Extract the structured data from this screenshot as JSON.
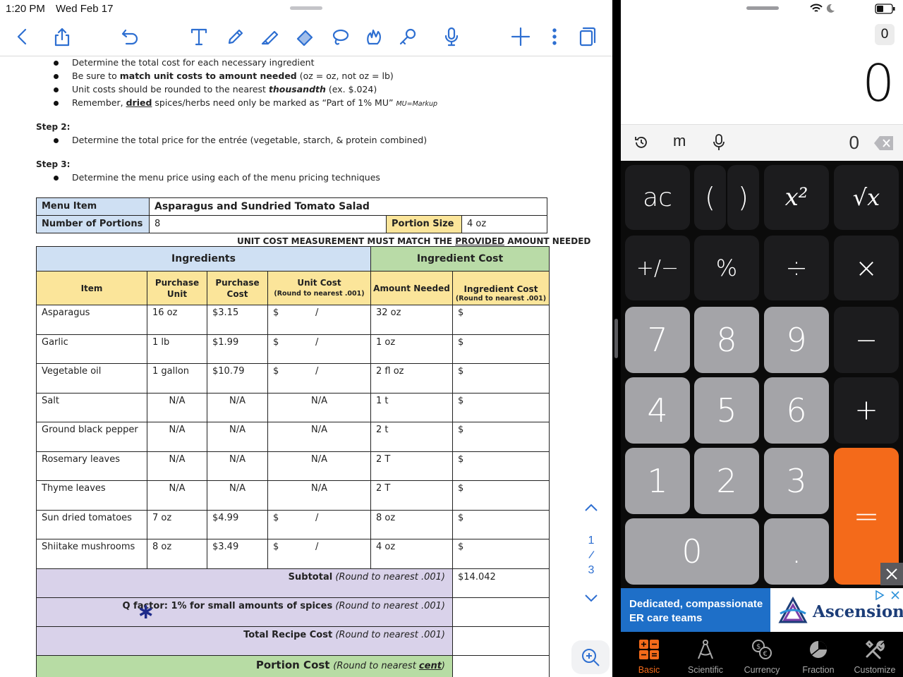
{
  "status_bar": {
    "time": "1:20 PM",
    "date": "Wed Feb 17"
  },
  "toolbar": {
    "icons": [
      "back-icon",
      "share-icon",
      "undo-icon",
      "text-tool-icon",
      "pen-icon",
      "highlighter-icon",
      "eraser-icon",
      "lasso-icon",
      "shapes-icon",
      "laser-pointer-icon",
      "microphone-icon",
      "add-icon",
      "more-icon",
      "pages-icon"
    ],
    "accent": "#2e6fd1"
  },
  "doc": {
    "bullets_step1": [
      "Determine the total cost for each necessary ingredient",
      "Be sure to match unit costs to amount needed (oz = oz, not oz = lb)",
      "Unit costs should be rounded to the nearest thousandth (ex. $.024)",
      "Remember, dried spices/herbs need only be marked as “Part of 1% MU” MU=Markup"
    ],
    "b2_pre": "Be sure to ",
    "b2_bold": "match unit costs to amount needed",
    "b2_post": " (oz = oz, not oz = lb)",
    "b3_pre": "Unit costs should be rounded to the nearest ",
    "b3_em": "thousandth",
    "b3_post": " (ex. $.024)",
    "b4_pre": "Remember, ",
    "b4_u": "dried",
    "b4_post": " spices/herbs need only be marked as “Part of 1% MU” ",
    "b4_note": "MU=Markup",
    "step2_label": "Step 2:",
    "step2_bullet": "Determine the total price for the entrée (vegetable, starch, & protein combined)",
    "step3_label": "Step 3:",
    "step3_bullet": "Determine the menu price using each of the menu pricing techniques"
  },
  "menu_table": {
    "menu_item_label": "Menu Item",
    "menu_item_value": "Asparagus and Sundried Tomato Salad",
    "portions_label": "Number of Portions",
    "portions_value": "8",
    "portion_size_label": "Portion Size",
    "portion_size_value": "4 oz"
  },
  "unit_note": {
    "pre": "UNIT COST MEASUREMENT MUST MATCH THE ",
    "u": "PROVIDED",
    "post": " AMOUNT NEEDED"
  },
  "ingredients_table": {
    "group_ingredients": "Ingredients",
    "group_cost": "Ingredient Cost",
    "headers": {
      "item": "Item",
      "purchase_unit_1": "Purchase",
      "purchase_unit_2": "Unit",
      "purchase_cost_1": "Purchase",
      "purchase_cost_2": "Cost",
      "unit_cost": "Unit Cost",
      "unit_cost_note": "(Round to nearest .001)",
      "amount_needed": "Amount Needed",
      "ingredient_cost": "Ingredient Cost",
      "ingredient_cost_note": "(Round to nearest .001)"
    },
    "rows": [
      {
        "item": "Asparagus",
        "unit": "16 oz",
        "cost": "$3.15",
        "uc_dollar": "$",
        "uc_slash": "/",
        "uc_na": "",
        "amount": "32 oz",
        "ic": "$"
      },
      {
        "item": "Garlic",
        "unit": "1 lb",
        "cost": "$1.99",
        "uc_dollar": "$",
        "uc_slash": "/",
        "uc_na": "",
        "amount": "1 oz",
        "ic": "$"
      },
      {
        "item": "Vegetable oil",
        "unit": "1 gallon",
        "cost": "$10.79",
        "uc_dollar": "$",
        "uc_slash": "/",
        "uc_na": "",
        "amount": "2 fl oz",
        "ic": "$"
      },
      {
        "item": "Salt",
        "unit": "N/A",
        "cost": "N/A",
        "uc_dollar": "",
        "uc_slash": "",
        "uc_na": "N/A",
        "amount": "1 t",
        "ic": "$"
      },
      {
        "item": "Ground black pepper",
        "unit": "N/A",
        "cost": "N/A",
        "uc_dollar": "",
        "uc_slash": "",
        "uc_na": "N/A",
        "amount": "2 t",
        "ic": "$"
      },
      {
        "item": "Rosemary leaves",
        "unit": "N/A",
        "cost": "N/A",
        "uc_dollar": "",
        "uc_slash": "",
        "uc_na": "N/A",
        "amount": "2 T",
        "ic": "$"
      },
      {
        "item": "Thyme leaves",
        "unit": "N/A",
        "cost": "N/A",
        "uc_dollar": "",
        "uc_slash": "",
        "uc_na": "N/A",
        "amount": "2 T",
        "ic": "$"
      },
      {
        "item": "Sun dried tomatoes",
        "unit": "7 oz",
        "cost": "$4.99",
        "uc_dollar": "$",
        "uc_slash": "/",
        "uc_na": "",
        "amount": "8 oz",
        "ic": "$"
      },
      {
        "item": "Shiitake mushrooms",
        "unit": "8 oz",
        "cost": "$3.49",
        "uc_dollar": "$",
        "uc_slash": "/",
        "uc_na": "",
        "amount": "4 oz",
        "ic": "$"
      }
    ],
    "subtotal_label": "Subtotal",
    "subtotal_note": "(Round to nearest .001)",
    "subtotal_value": "$14.042",
    "qfactor_label": "Q factor: 1% for small amounts of spices",
    "qfactor_note": "(Round to nearest .001)",
    "total_label": "Total Recipe Cost",
    "total_note": "(Round to nearest .001)",
    "portion_label": "Portion Cost",
    "portion_note_pre": "(Round to nearest ",
    "portion_note_u": "cent",
    "portion_note_post": ")",
    "star_mark": "∗"
  },
  "pager": {
    "current": "1",
    "sep": "/",
    "total": "3"
  },
  "calculator": {
    "memory": "0",
    "display": "0",
    "history_value": "0",
    "memory_key": "m",
    "keys": {
      "ac": "ac",
      "paren_open": "(",
      "paren_close": ")",
      "square": "x²",
      "sqrt": "√x",
      "plusminus": "+/−",
      "percent": "%",
      "divide": "÷",
      "multiply": "×",
      "seven": "7",
      "eight": "8",
      "nine": "9",
      "minus": "−",
      "four": "4",
      "five": "5",
      "six": "6",
      "plus": "+",
      "one": "1",
      "two": "2",
      "three": "3",
      "equals": "=",
      "zero": "0",
      "decimal": "."
    },
    "accent": "#f46a1a"
  },
  "ad": {
    "line1": "Dedicated, compassionate",
    "line2": "ER care teams",
    "brand": "Ascension"
  },
  "tabs": [
    {
      "label": "Basic",
      "icon": "basic-calculator-icon",
      "active": true
    },
    {
      "label": "Scientific",
      "icon": "compass-icon",
      "active": false
    },
    {
      "label": "Currency",
      "icon": "currency-exchange-icon",
      "active": false
    },
    {
      "label": "Fraction",
      "icon": "fraction-pie-icon",
      "active": false
    },
    {
      "label": "Customize",
      "icon": "tools-icon",
      "active": false
    }
  ]
}
